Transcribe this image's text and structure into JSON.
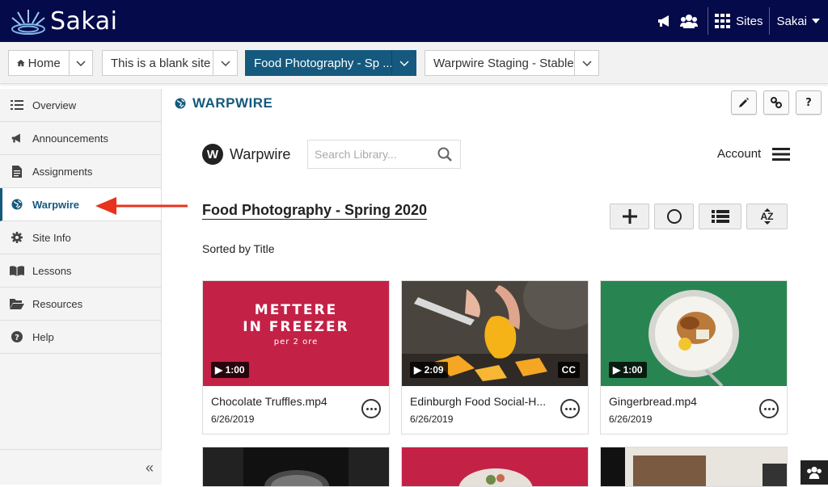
{
  "app": {
    "name": "Sakai"
  },
  "topbar": {
    "sites_label": "Sites",
    "user_label": "Sakai"
  },
  "site_tabs": [
    {
      "label": "Home"
    },
    {
      "label": "This is a blank site"
    },
    {
      "label": "Food Photography - Sp ..."
    },
    {
      "label": "Warpwire Staging - Stable"
    }
  ],
  "sidebar": {
    "items": [
      {
        "label": "Overview"
      },
      {
        "label": "Announcements"
      },
      {
        "label": "Assignments"
      },
      {
        "label": "Warpwire"
      },
      {
        "label": "Site Info"
      },
      {
        "label": "Lessons"
      },
      {
        "label": "Resources"
      },
      {
        "label": "Help"
      }
    ],
    "active": "Warpwire",
    "collapse_glyph": "«"
  },
  "tool": {
    "title": "WARPWIRE"
  },
  "warpwire": {
    "brand": "Warpwire",
    "search_placeholder": "Search Library...",
    "account_label": "Account",
    "library_title": "Food Photography - Spring 2020",
    "sorted_label": "Sorted by Title",
    "sort_icon_text": "AZ"
  },
  "videos": [
    {
      "title": "Chocolate Truffles.mp4",
      "date": "6/26/2019",
      "duration": "1:00",
      "cc": false,
      "thumb_text": [
        "METTERE",
        "IN FREEZER",
        "per 2 ore"
      ]
    },
    {
      "title": "Edinburgh Food Social-H...",
      "date": "6/26/2019",
      "duration": "2:09",
      "cc": true,
      "cc_label": "CC"
    },
    {
      "title": "Gingerbread.mp4",
      "date": "6/26/2019",
      "duration": "1:00",
      "cc": false
    }
  ],
  "colors": {
    "topbar": "#050a4a",
    "accent": "#15597e",
    "arrow": "#e8321e"
  }
}
